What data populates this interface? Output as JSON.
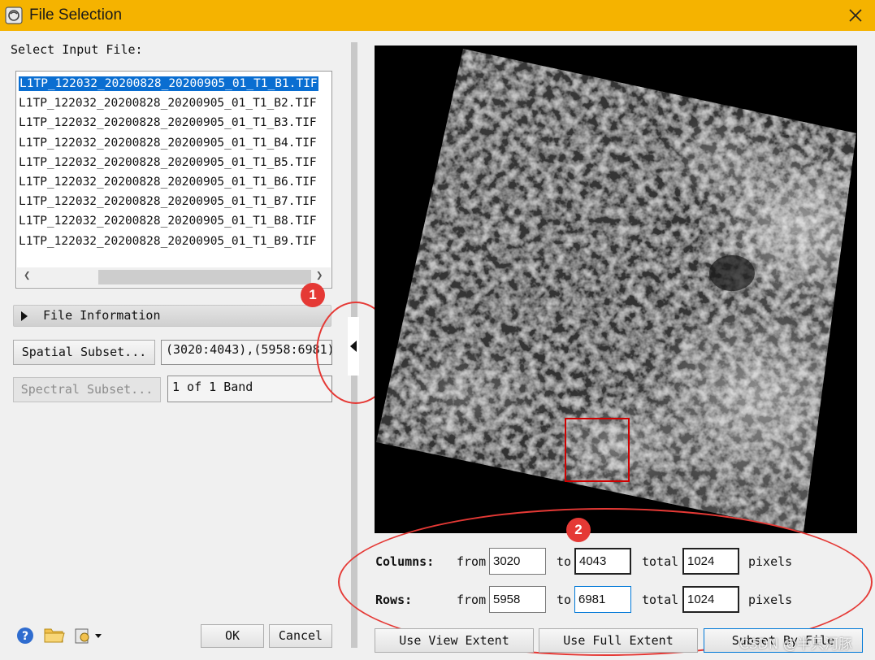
{
  "window": {
    "title": "File Selection"
  },
  "input_panel": {
    "label": "Select Input File:",
    "files": [
      "L1TP_122032_20200828_20200905_01_T1_B1.TIF",
      "L1TP_122032_20200828_20200905_01_T1_B2.TIF",
      "L1TP_122032_20200828_20200905_01_T1_B3.TIF",
      "L1TP_122032_20200828_20200905_01_T1_B4.TIF",
      "L1TP_122032_20200828_20200905_01_T1_B5.TIF",
      "L1TP_122032_20200828_20200905_01_T1_B6.TIF",
      "L1TP_122032_20200828_20200905_01_T1_B7.TIF",
      "L1TP_122032_20200828_20200905_01_T1_B8.TIF",
      "L1TP_122032_20200828_20200905_01_T1_B9.TIF"
    ],
    "selected_index": 0,
    "file_info_label": "File Information",
    "spatial_subset_button": "Spatial Subset...",
    "spatial_subset_value": "(3020:4043),(5958:6981)",
    "spectral_subset_button": "Spectral Subset...",
    "spectral_subset_value": "1 of 1 Band",
    "ok_button": "OK",
    "cancel_button": "Cancel"
  },
  "annotations": {
    "badge1": "1",
    "badge2": "2"
  },
  "subset": {
    "columns_label": "Columns:",
    "rows_label": "Rows:",
    "from_label": "from",
    "to_label": "to",
    "total_label": "total",
    "pixels_label": "pixels",
    "columns_from": "3020",
    "columns_to": "4043",
    "columns_total": "1024",
    "rows_from": "5958",
    "rows_to": "6981",
    "rows_total": "1024",
    "use_view_extent_button": "Use View Extent",
    "use_full_extent_button": "Use Full Extent",
    "subset_by_file_button": "Subset By File"
  },
  "watermark": "CSDN @半只河豚",
  "colors": {
    "titlebar": "#f5b300",
    "selection": "#0a6ed1",
    "annotation": "#e53935"
  }
}
